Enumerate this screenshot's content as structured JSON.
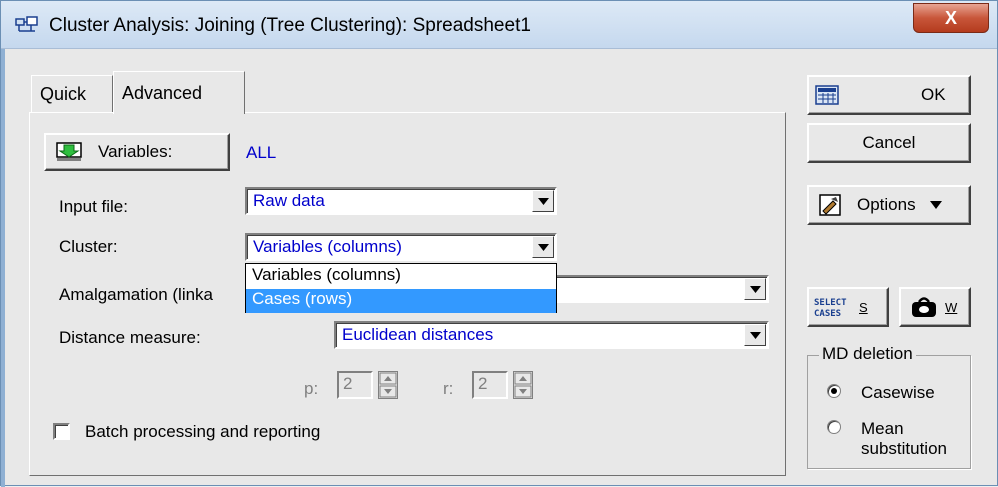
{
  "window": {
    "title": "Cluster Analysis: Joining (Tree Clustering): Spreadsheet1",
    "close_label": "X"
  },
  "tabs": [
    {
      "label": "Quick"
    },
    {
      "label": "Advanced"
    }
  ],
  "variables": {
    "button_label": "Variables:",
    "value": "ALL"
  },
  "form": {
    "input_file": {
      "label": "Input file:",
      "value": "Raw data"
    },
    "cluster": {
      "label": "Cluster:",
      "value": "Variables (columns)"
    },
    "amalgamation": {
      "label": "Amalgamation (linka",
      "value": ""
    },
    "distance": {
      "label": "Distance measure:",
      "value": "Euclidean distances"
    },
    "p": {
      "label": "p:",
      "value": "2"
    },
    "r": {
      "label": "r:",
      "value": "2"
    },
    "batch": {
      "label": "Batch processing and reporting",
      "checked": false
    }
  },
  "cluster_dropdown": {
    "options": [
      "Variables (columns)",
      "Cases (rows)"
    ],
    "highlighted": "Cases (rows)"
  },
  "sidebar": {
    "ok_label": "OK",
    "cancel_label": "Cancel",
    "options_label": "Options",
    "select_cases_icon_text": "SELECT CASES",
    "select_cases_key": "S",
    "weight_key": "W"
  },
  "md_deletion": {
    "title": "MD deletion",
    "options": [
      {
        "label": "Casewise",
        "selected": true
      },
      {
        "label": "Mean substitution",
        "selected": false
      }
    ]
  },
  "colors": {
    "accent_blue": "#0000cc",
    "selection": "#3399ff",
    "close_red": "#c8563a"
  }
}
